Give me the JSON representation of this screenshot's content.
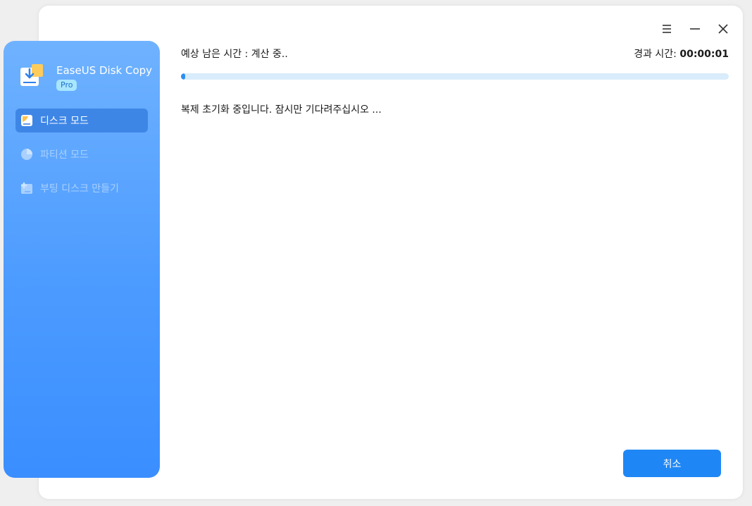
{
  "app": {
    "name": "EaseUS Disk Copy",
    "badge": "Pro"
  },
  "sidebar": {
    "items": [
      {
        "label": "디스크 모드",
        "icon": "disk-mode-icon",
        "active": true
      },
      {
        "label": "파티션 모드",
        "icon": "pie-chart-icon",
        "active": false
      },
      {
        "label": "부팅 디스크 만들기",
        "icon": "bootable-disk-icon",
        "active": false
      }
    ]
  },
  "window_controls": {
    "menu": "menu-icon",
    "minimize": "minimize-icon",
    "close": "close-icon"
  },
  "progress": {
    "remaining_label": "예상 남은 시간 : 계산 중..",
    "elapsed_label": "경과 시간: ",
    "elapsed_value": "00:00:01",
    "fraction": 0.008,
    "status_message": "복제 초기화 중입니다. 잠시만 기다려주십시오 ..."
  },
  "actions": {
    "cancel_label": "취소"
  },
  "colors": {
    "accent": "#1f87f5",
    "sidebar_top": "#6fb2ff",
    "sidebar_bottom": "#3a8eff",
    "progress_track": "#d8ecfb"
  }
}
